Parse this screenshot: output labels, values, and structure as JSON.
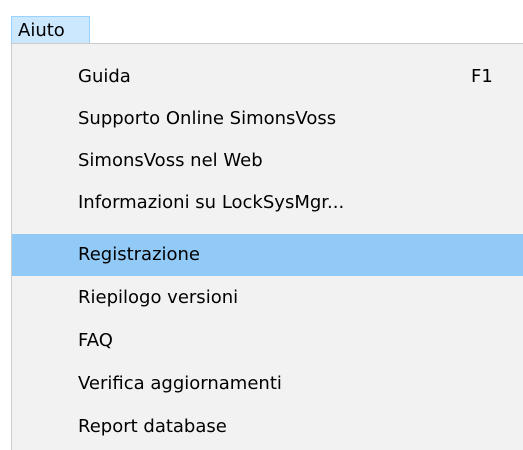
{
  "menubar": {
    "active_menu": "Aiuto"
  },
  "dropdown": {
    "items": [
      {
        "label": "Guida",
        "shortcut": "F1"
      },
      {
        "label": "Supporto Online SimonsVoss",
        "shortcut": ""
      },
      {
        "label": "SimonsVoss nel Web",
        "shortcut": ""
      },
      {
        "label": "Informazioni su LockSysMgr...",
        "shortcut": ""
      },
      {
        "label": "Registrazione",
        "shortcut": "",
        "highlighted": true
      },
      {
        "label": "Riepilogo versioni",
        "shortcut": ""
      },
      {
        "label": "FAQ",
        "shortcut": ""
      },
      {
        "label": "Verifica aggiornamenti",
        "shortcut": ""
      },
      {
        "label": "Report database",
        "shortcut": ""
      }
    ]
  },
  "colors": {
    "menubar_active_bg": "#cce8ff",
    "menu_bg": "#f2f2f2",
    "highlight_bg": "#91c9f7"
  }
}
